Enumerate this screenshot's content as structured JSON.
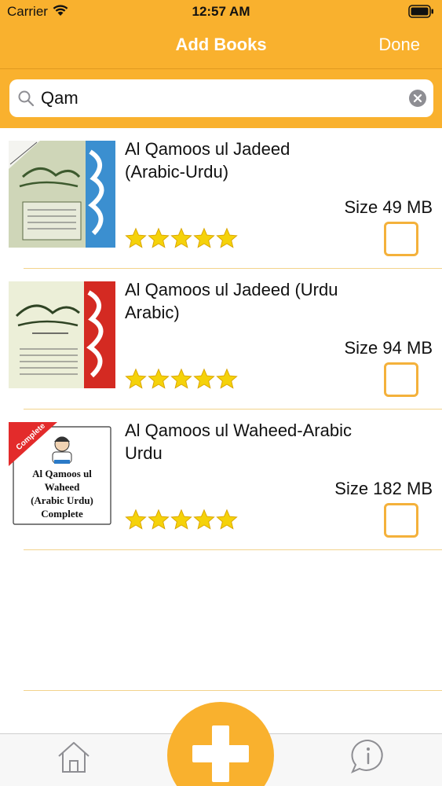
{
  "status_bar": {
    "carrier": "Carrier",
    "time": "12:57 AM"
  },
  "nav": {
    "title": "Add Books",
    "done_label": "Done"
  },
  "search": {
    "value": "Qam",
    "placeholder": ""
  },
  "colors": {
    "brand": "#f9b12e",
    "checkbox_border": "#f4b13b",
    "star": "#f5d20a",
    "divider": "#f3d38c"
  },
  "books": [
    {
      "title": "Al Qamoos ul Jadeed (Arabic-Urdu)",
      "size": "Size 49 MB",
      "rating": 5,
      "selected": false,
      "cover": "book-cover-image"
    },
    {
      "title": "Al Qamoos ul Jadeed (Urdu Arabic)",
      "size": "Size 94 MB",
      "rating": 5,
      "selected": false,
      "cover": "book-cover-image"
    },
    {
      "title": "Al Qamoos ul Waheed-Arabic Urdu",
      "size": "Size 182 MB",
      "rating": 5,
      "selected": false,
      "cover": "book-cover-image",
      "cover_ribbon": "Complete",
      "cover_text": [
        "Al Qamoos ul",
        "Waheed",
        "(Arabic Urdu)",
        "Complete"
      ]
    }
  ],
  "tab_bar": {
    "items": [
      "home-icon",
      "add-icon",
      "info-icon"
    ]
  }
}
